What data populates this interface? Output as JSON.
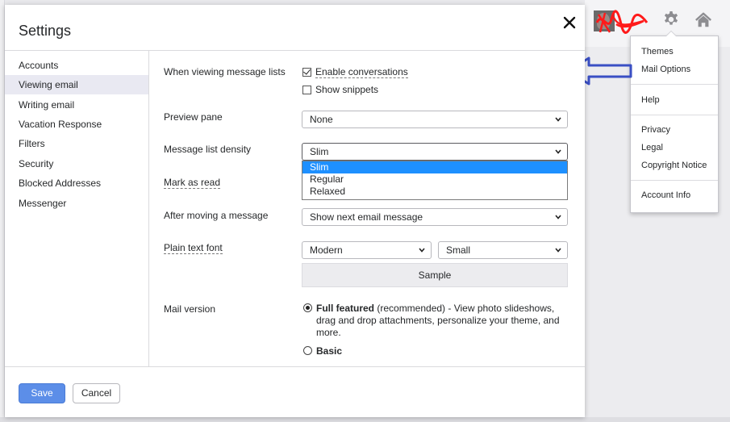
{
  "dialog": {
    "title": "Settings",
    "close_icon": "close-icon"
  },
  "sidebar": {
    "items": [
      {
        "label": "Accounts"
      },
      {
        "label": "Viewing email",
        "active": true
      },
      {
        "label": "Writing email"
      },
      {
        "label": "Vacation Response"
      },
      {
        "label": "Filters"
      },
      {
        "label": "Security"
      },
      {
        "label": "Blocked Addresses"
      },
      {
        "label": "Messenger"
      }
    ]
  },
  "viewing": {
    "message_lists": {
      "label": "When viewing message lists",
      "enable_conversations": {
        "label": "Enable conversations",
        "checked": true
      },
      "show_snippets": {
        "label": "Show snippets",
        "checked": false
      }
    },
    "preview_pane": {
      "label": "Preview pane",
      "value": "None"
    },
    "density": {
      "label": "Message list density",
      "value": "Slim",
      "options": [
        "Slim",
        "Regular",
        "Relaxed"
      ],
      "highlighted": "Slim"
    },
    "mark_as_read": {
      "label": "Mark as read"
    },
    "after_moving": {
      "label": "After moving a message",
      "value": "Show next email message"
    },
    "plain_text_font": {
      "label": "Plain text font",
      "font_value": "Modern",
      "size_value": "Small",
      "sample_label": "Sample"
    },
    "mail_version": {
      "label": "Mail version",
      "full_title": "Full featured",
      "full_desc": " (recommended) - View photo slideshows, drag and drop attachments, personalize your theme, and more.",
      "basic_title": "Basic",
      "selected": "Full featured"
    }
  },
  "footer": {
    "save_label": "Save",
    "cancel_label": "Cancel"
  },
  "header_right": {
    "icons": [
      "avatar",
      "gear-icon",
      "home-icon"
    ]
  },
  "settings_menu": {
    "items": [
      "Themes",
      "Mail Options",
      "Help",
      "Privacy",
      "Legal",
      "Copyright Notice",
      "Account Info"
    ]
  },
  "colors": {
    "primary_button": "#5c8ee8",
    "selected_option": "#1e90ff",
    "active_sidebar": "#e9e9f2",
    "annotation_arrow": "#3a4fc4",
    "annotation_scribble": "#ff1a1a"
  }
}
